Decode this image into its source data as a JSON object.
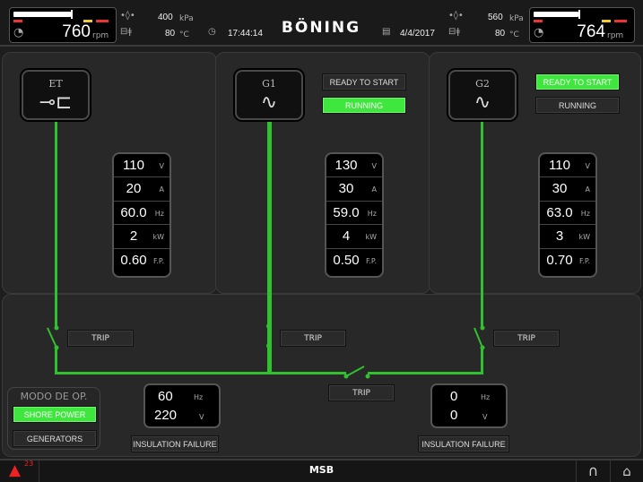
{
  "header": {
    "brand": "BÖNING",
    "time": "17:44:14",
    "date": "4/4/2017",
    "left_engine": {
      "rpm": "760",
      "rpm_unit": "rpm",
      "load_fraction": 0.65
    },
    "left_readings": {
      "pressure": "400",
      "pressure_unit": "kPa",
      "temp": "80",
      "temp_unit": "°C"
    },
    "right_readings": {
      "pressure": "560",
      "pressure_unit": "kPa",
      "temp": "80",
      "temp_unit": "°C"
    },
    "right_engine": {
      "rpm": "764",
      "rpm_unit": "rpm",
      "load_fraction": 0.66
    }
  },
  "sources": {
    "et": {
      "label": "ET",
      "icon": "plug-icon",
      "readings": [
        {
          "value": "110",
          "unit": "V"
        },
        {
          "value": "20",
          "unit": "A"
        },
        {
          "value": "60.0",
          "unit": "Hz"
        },
        {
          "value": "2",
          "unit": "kW"
        },
        {
          "value": "0.60",
          "unit": "F.P."
        }
      ]
    },
    "g1": {
      "label": "G1",
      "icon": "sine-wave-icon",
      "ready": "READY TO START",
      "running": "RUNNING",
      "readings": [
        {
          "value": "130",
          "unit": "V"
        },
        {
          "value": "30",
          "unit": "A"
        },
        {
          "value": "59.0",
          "unit": "Hz"
        },
        {
          "value": "4",
          "unit": "kW"
        },
        {
          "value": "0.50",
          "unit": "F.P."
        }
      ]
    },
    "g2": {
      "label": "G2",
      "icon": "sine-wave-icon",
      "ready": "READY TO START",
      "running": "RUNNING",
      "readings": [
        {
          "value": "110",
          "unit": "V"
        },
        {
          "value": "30",
          "unit": "A"
        },
        {
          "value": "63.0",
          "unit": "Hz"
        },
        {
          "value": "3",
          "unit": "kW"
        },
        {
          "value": "0.70",
          "unit": "F.P."
        }
      ]
    }
  },
  "bus": {
    "trip_et": "TRIP",
    "trip_g1": "TRIP",
    "trip_g2": "TRIP",
    "trip_tie": "TRIP",
    "left_bus": {
      "freq": "60",
      "freq_unit": "Hz",
      "volt": "220",
      "volt_unit": "V",
      "insulation": "INSULATION FAILURE"
    },
    "right_bus": {
      "freq": "0",
      "freq_unit": "Hz",
      "volt": "0",
      "volt_unit": "V",
      "insulation": "INSULATION FAILURE"
    }
  },
  "mode": {
    "title": "MODO DE OP.",
    "shore": "SHORE POWER",
    "generators": "GENERATORS"
  },
  "footer": {
    "title": "MSB",
    "alarm_count": "23"
  },
  "colors": {
    "green": "#3ee63e",
    "line_green": "#30c030"
  }
}
